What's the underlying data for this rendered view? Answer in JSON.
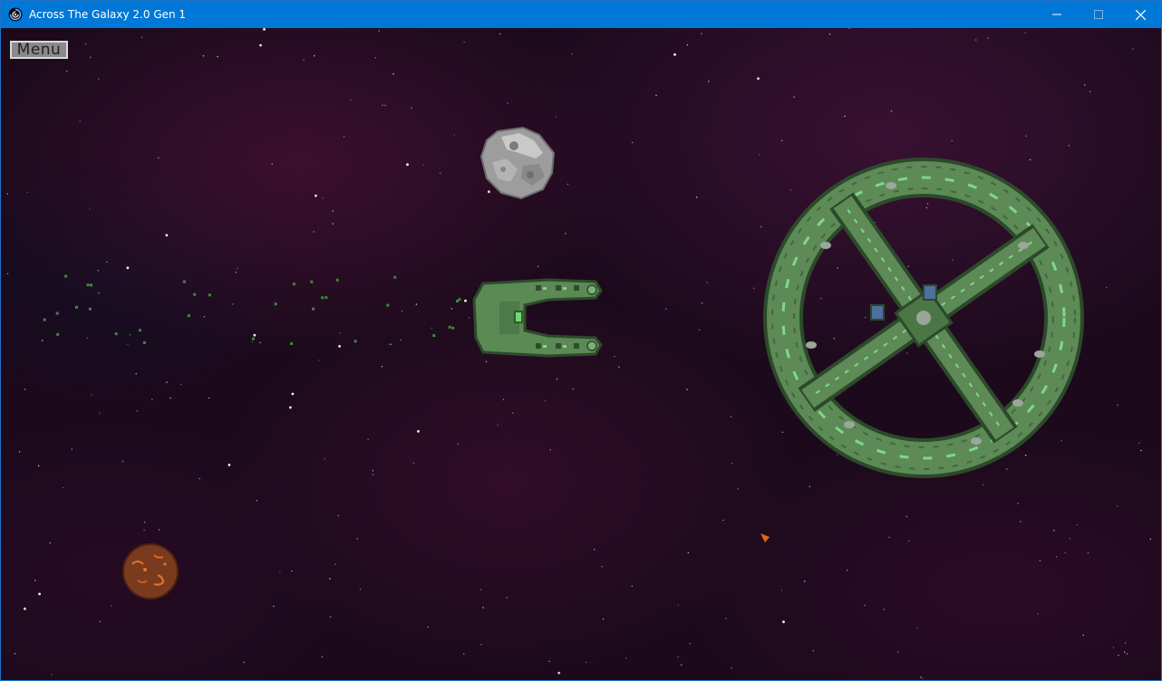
{
  "window": {
    "title": "Across The Galaxy 2.0 Gen 1",
    "icon": "galaxy-swirl-icon",
    "titlebar_color": "#0078d7",
    "controls": [
      "minimize-icon",
      "maximize-icon",
      "close-icon"
    ]
  },
  "hud": {
    "menu_label": "Menu"
  },
  "scene": {
    "background": "purple nebula starfield",
    "objects": [
      {
        "name": "space-station",
        "color": "#5d8a57"
      },
      {
        "name": "player-ship",
        "color": "#5b8a55"
      },
      {
        "name": "asteroid",
        "color": "#a9a9a9"
      },
      {
        "name": "planet",
        "color": "#7a3a1e"
      },
      {
        "name": "orange-marker",
        "color": "#e06a10"
      },
      {
        "name": "debris-particles",
        "color": "#3f8a3a"
      }
    ]
  }
}
